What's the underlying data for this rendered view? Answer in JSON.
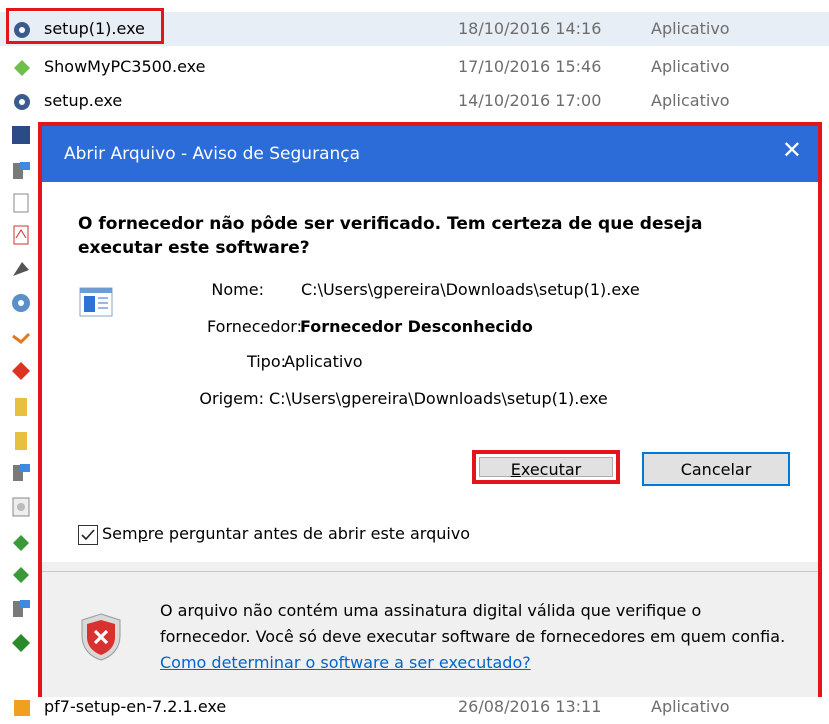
{
  "files": [
    {
      "name": "setup(1).exe",
      "date": "18/10/2016 14:16",
      "type": "Aplicativo"
    },
    {
      "name": "ShowMyPC3500.exe",
      "date": "17/10/2016 15:46",
      "type": "Aplicativo"
    },
    {
      "name": "setup.exe",
      "date": "14/10/2016 17:00",
      "type": "Aplicativo"
    },
    {
      "name": "pf7-setup-en-7.2.1.exe",
      "date": "26/08/2016 13:11",
      "type": "Aplicativo"
    }
  ],
  "dialog": {
    "title": "Abrir Arquivo - Aviso de Segurança",
    "close_glyph": "✕",
    "question": "O fornecedor não pôde ser verificado. Tem certeza de que deseja executar este software?",
    "name_label": "Nome:",
    "name_value": "C:\\Users\\gpereira\\Downloads\\setup(1).exe",
    "publisher_label": "Fornecedor:",
    "publisher_value": "Fornecedor Desconhecido",
    "type_label": "Tipo:",
    "type_value": "Aplicativo",
    "origin_label": "Origem:",
    "origin_value": "C:\\Users\\gpereira\\Downloads\\setup(1).exe",
    "run_button": "Executar",
    "cancel_button": "Cancelar",
    "checkbox_label": "Sempre perguntar antes de abrir este arquivo",
    "checkbox_checked": true,
    "warning_text": "O arquivo não contém uma assinatura digital válida que verifique o fornecedor. Você só deve executar software de fornecedores em quem confia.",
    "help_link": "Como determinar o software a ser executado?"
  },
  "colors": {
    "titlebar": "#2b6cd8",
    "highlight": "#e4141b",
    "link": "#0066cc"
  }
}
